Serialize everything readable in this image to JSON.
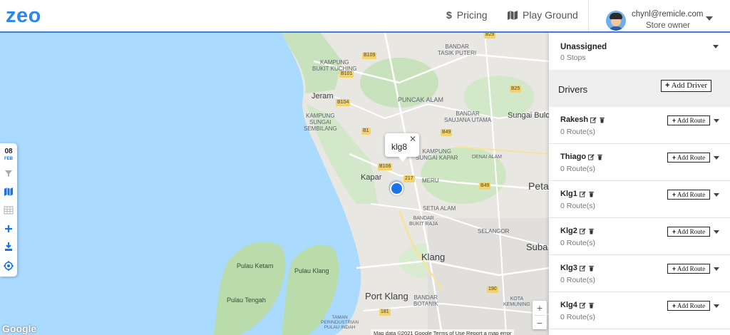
{
  "header": {
    "logo": "zeo",
    "nav": [
      {
        "icon": "dollar-icon",
        "label": "Pricing"
      },
      {
        "icon": "map-icon",
        "label": "Play Ground"
      }
    ],
    "user": {
      "email": "chynl@remicle.com",
      "role": "Store owner"
    }
  },
  "map": {
    "popup_label": "klg8",
    "labels": {
      "kampung_bukit_kuching": "KAMPUNG\nBUKIT KUCHING",
      "bandar_tasik_puteri": "BANDAR\nTASIK PUTERI",
      "jeram": "Jeram",
      "puncak_alam": "PUNCAK ALAM",
      "kampung_sungai_sembilang": "KAMPUNG\nSUNGAI\nSEMBILANG",
      "bandar_saujana_utama": "BANDAR\nSAUJANA UTAMA",
      "sungai_buloh": "Sungai Bulo",
      "kampung_kapar": "KAMPUNG\nSUNGAI KAPAR",
      "denai_alam": "DENAI ALAM",
      "kapar": "Kapar",
      "meru": "MERU",
      "petaling": "Peta",
      "setia_alam": "SETIA ALAM",
      "bandar_bukit_raja": "BANDAR\nBUKIT RAJA",
      "selangor": "SELANGOR",
      "subang": "Suba",
      "klang": "Klang",
      "pulau_ketam": "Pulau Ketam",
      "pulau_klang": "Pulau Klang",
      "pulau_tengah": "Pulau Tengah",
      "port_klang": "Port Klang",
      "bandar_botanik": "BANDAR\nBOTANIK",
      "kota_kemuning": "KOTA\nKEMUNING",
      "taman_perindustrian": "TAMAN\nPERINDUSTRIAN\nPULAU INDAH"
    },
    "road_badges": {
      "b29": "B29",
      "b109": "B109",
      "b25": "B25",
      "b101": "B101",
      "b104": "B104",
      "b1": "B1",
      "b49": "B49",
      "b106": "B106",
      "r217": "217",
      "b49b": "B49",
      "r190": "190",
      "r181": "181"
    },
    "attribution": "Map data ©2021 Google    Terms of Use    Report a map error",
    "google_logo": "Google",
    "zoom_in": "+",
    "zoom_out": "−"
  },
  "toolbar": {
    "day": "08",
    "month": "FEB"
  },
  "panel": {
    "unassigned": {
      "title": "Unassigned",
      "stops": "0 Stops"
    },
    "drivers_title": "Drivers",
    "add_driver": "Add Driver",
    "add_route": "Add Route",
    "drivers": [
      {
        "name": "Rakesh",
        "routes": "0 Route(s)"
      },
      {
        "name": "Thiago",
        "routes": "0 Route(s)"
      },
      {
        "name": "Klg1",
        "routes": "0 Route(s)"
      },
      {
        "name": "Klg2",
        "routes": "0 Route(s)"
      },
      {
        "name": "Klg3",
        "routes": "0 Route(s)"
      },
      {
        "name": "Klg4",
        "routes": "0 Route(s)"
      }
    ]
  },
  "colors": {
    "accent": "#1a73e8",
    "water": "#aadaff",
    "land": "#e9e7e2",
    "park": "#c8e2bd"
  }
}
